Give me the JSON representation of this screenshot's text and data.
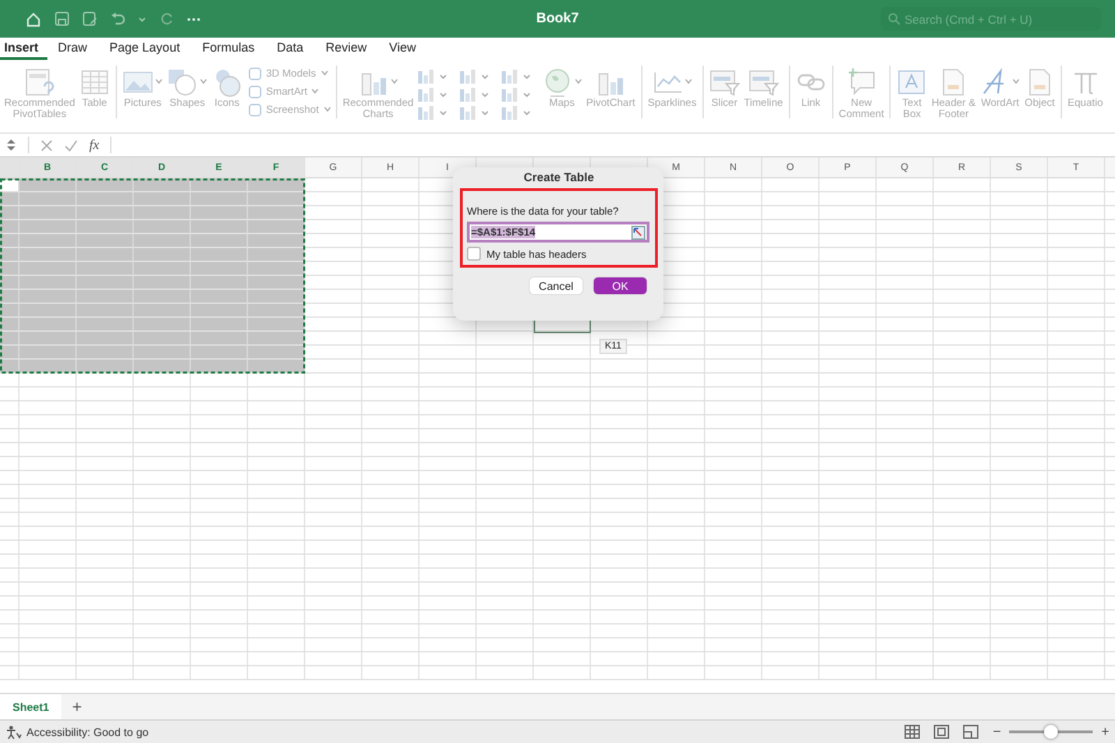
{
  "window": {
    "title": "Book7",
    "search": {
      "placeholder": "Search (Cmd + Ctrl + U)"
    }
  },
  "tabs": [
    {
      "label": "Insert",
      "selected": true
    },
    {
      "label": "Draw",
      "selected": false
    },
    {
      "label": "Page Layout",
      "selected": false
    },
    {
      "label": "Formulas",
      "selected": false
    },
    {
      "label": "Data",
      "selected": false
    },
    {
      "label": "Review",
      "selected": false
    },
    {
      "label": "View",
      "selected": false
    }
  ],
  "ribbon": {
    "disabled": true,
    "groups": [
      {
        "items": [
          {
            "kind": "large",
            "label": "Recommended\nPivotTables",
            "caret": false
          },
          {
            "kind": "large",
            "label": "Table",
            "caret": false
          }
        ]
      },
      {
        "items": [
          {
            "kind": "large",
            "label": "Pictures",
            "caret": true
          },
          {
            "kind": "large",
            "label": "Shapes",
            "caret": true
          },
          {
            "kind": "large",
            "label": "Icons",
            "caret": false
          },
          {
            "kind": "stack",
            "children": [
              {
                "label": "3D Models",
                "caret": true
              },
              {
                "label": "SmartArt",
                "caret": true
              },
              {
                "label": "Screenshot",
                "caret": true
              }
            ]
          }
        ]
      },
      {
        "items": [
          {
            "kind": "large",
            "label": "Recommended\nCharts",
            "caret": true
          },
          {
            "kind": "chart-grid"
          },
          {
            "kind": "large",
            "label": "Maps",
            "caret": true
          },
          {
            "kind": "large",
            "label": "PivotChart",
            "caret": false
          }
        ]
      },
      {
        "items": [
          {
            "kind": "large",
            "label": "Sparklines",
            "caret": true
          }
        ]
      },
      {
        "items": [
          {
            "kind": "large",
            "label": "Slicer",
            "caret": false
          },
          {
            "kind": "large",
            "label": "Timeline",
            "caret": false
          }
        ]
      },
      {
        "items": [
          {
            "kind": "large",
            "label": "Link",
            "caret": false
          }
        ]
      },
      {
        "items": [
          {
            "kind": "large",
            "label": "New\nComment",
            "caret": false
          }
        ]
      },
      {
        "items": [
          {
            "kind": "large",
            "label": "Text\nBox",
            "caret": false
          },
          {
            "kind": "large",
            "label": "Header &\nFooter",
            "caret": false
          },
          {
            "kind": "large",
            "label": "WordArt",
            "caret": true
          },
          {
            "kind": "large",
            "label": "Object",
            "caret": false
          }
        ]
      },
      {
        "items": [
          {
            "kind": "large",
            "label": "Equatio",
            "caret": false
          }
        ]
      }
    ]
  },
  "formula_bar": {
    "fx": "fx"
  },
  "grid": {
    "columns": [
      {
        "active": true,
        "selected": true
      },
      {
        "label": "B",
        "selected": true
      },
      {
        "label": "C",
        "selected": true
      },
      {
        "label": "D",
        "selected": true
      },
      {
        "label": "E",
        "selected": true
      },
      {
        "label": "F",
        "selected": true
      },
      {
        "label": "G",
        "selected": false
      },
      {
        "label": "H",
        "selected": false
      },
      {
        "label": "I",
        "selected": false
      },
      {},
      {
        "current": true
      },
      {},
      {
        "label": "M",
        "selected": false
      },
      {
        "label": "N",
        "selected": false
      },
      {
        "label": "O",
        "selected": false
      },
      {
        "label": "P",
        "selected": false
      },
      {
        "label": "Q",
        "selected": false
      },
      {
        "label": "R",
        "selected": false
      },
      {
        "label": "S",
        "selected": false
      },
      {
        "label": "T",
        "selected": false
      },
      {}
    ],
    "rows": [
      {
        "selected": true,
        "active": true
      },
      {
        "selected": true
      },
      {
        "selected": true
      },
      {
        "selected": true
      },
      {
        "selected": true
      },
      {
        "selected": true
      },
      {
        "selected": true
      },
      {
        "selected": true
      },
      {
        "selected": true
      },
      {
        "selected": true
      },
      {
        "selected": true,
        "current": true
      },
      {
        "selected": true
      },
      {
        "selected": true
      },
      {
        "selected": true
      },
      {
        "selected": false
      },
      {
        "selected": false
      },
      {
        "selected": false
      },
      {
        "selected": false
      },
      {
        "selected": false
      },
      {
        "selected": false
      },
      {
        "selected": false
      },
      {
        "selected": false
      },
      {
        "selected": false
      },
      {
        "selected": false
      },
      {
        "selected": false
      },
      {
        "selected": false
      },
      {
        "selected": false
      },
      {
        "selected": false
      },
      {
        "selected": false
      },
      {
        "selected": false
      },
      {
        "selected": false
      },
      {
        "selected": false
      },
      {
        "selected": false
      },
      {
        "selected": false
      },
      {
        "selected": false
      },
      {
        "selected": false
      }
    ],
    "cell_tip": "K11"
  },
  "dialog": {
    "title": "Create Table",
    "prompt": "Where is the data for your table?",
    "range": "=$A$1:$F$14",
    "headers_checkbox": {
      "label": "My table has headers",
      "checked": false
    },
    "buttons": [
      {
        "label": "Cancel",
        "kind": "secondary"
      },
      {
        "label": "OK",
        "kind": "primary"
      }
    ]
  },
  "sheets": [
    {
      "label": "Sheet1",
      "selected": true
    }
  ],
  "add_sheet": "+",
  "status_bar": {
    "text": "Accessibility: Good to go",
    "zoom_out": "−",
    "zoom_in": "+",
    "zoom": {
      "level": 0.5
    }
  }
}
